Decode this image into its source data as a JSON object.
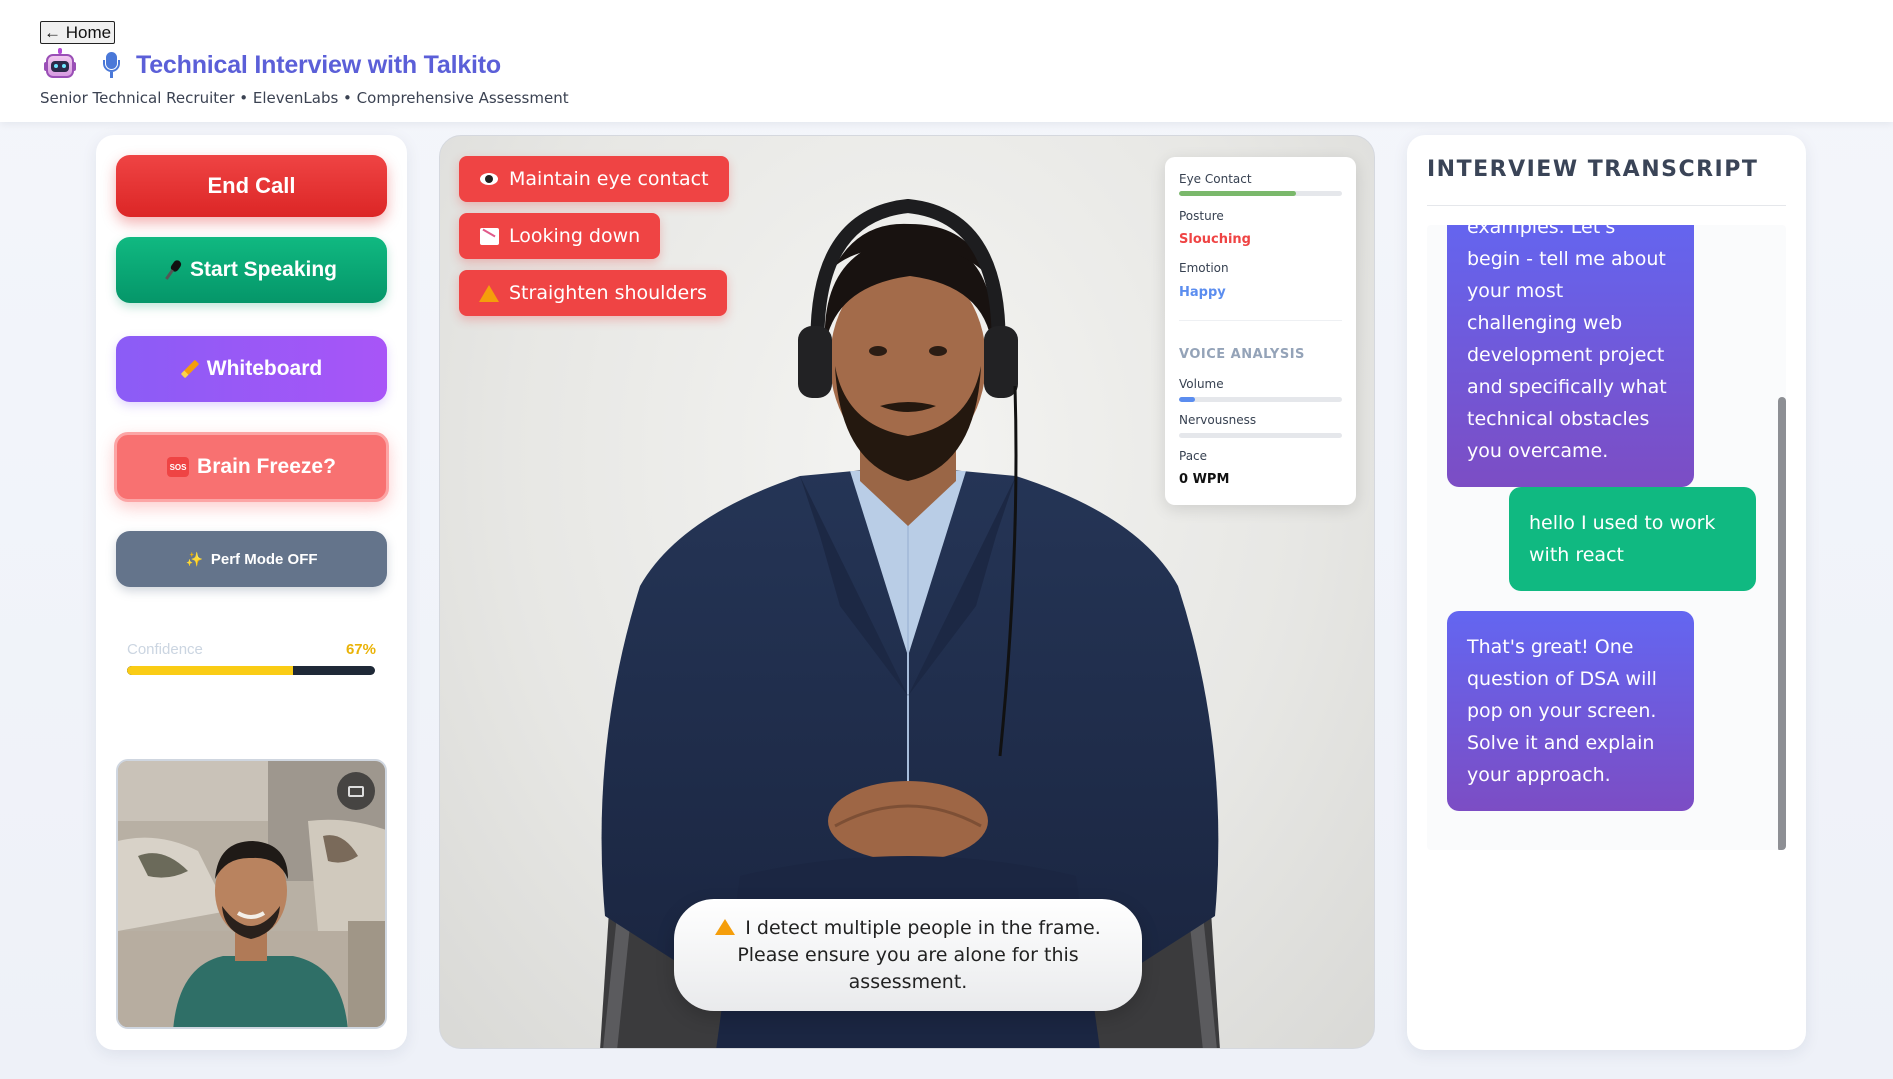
{
  "header": {
    "home_label": "← Home",
    "title": "Technical Interview with Talkito",
    "subtitle": "Senior Technical Recruiter • ElevenLabs • Comprehensive Assessment"
  },
  "controls": {
    "end_call": "End Call",
    "start_speaking": "Start Speaking",
    "whiteboard": "Whiteboard",
    "brain_freeze": "Brain Freeze?",
    "perf_mode": "Perf Mode OFF"
  },
  "confidence": {
    "label": "Confidence",
    "value": "67%",
    "fraction": 0.67
  },
  "alerts": [
    {
      "text": "Maintain eye contact",
      "icon": "eye-icon"
    },
    {
      "text": "Looking down",
      "icon": "chart-decreasing-icon"
    },
    {
      "text": "Straighten shoulders",
      "icon": "warning-icon"
    }
  ],
  "metrics": {
    "eye_contact_label": "Eye Contact",
    "eye_contact_fraction": 0.72,
    "posture_label": "Posture",
    "posture_value": "Slouching",
    "emotion_label": "Emotion",
    "emotion_value": "Happy",
    "voice_title": "VOICE ANALYSIS",
    "volume_label": "Volume",
    "volume_fraction": 0.1,
    "nervousness_label": "Nervousness",
    "nervousness_fraction": 0.0,
    "pace_label": "Pace",
    "pace_value": "0 WPM"
  },
  "toast": {
    "text": "I detect multiple people in the frame. Please ensure you are alone for this assessment."
  },
  "transcript": {
    "title": "INTERVIEW TRANSCRIPT",
    "messages": [
      {
        "role": "bot",
        "text": "examples. Let's begin - tell me about your most challenging web development project and specifically what technical obstacles you overcame."
      },
      {
        "role": "user",
        "text": "hello I used to work with react"
      },
      {
        "role": "bot",
        "text": "That's great! One question of DSA will pop on your screen. Solve it and explain your approach."
      }
    ]
  },
  "colors": {
    "accent": "#5b5fd8",
    "danger": "#ef4444",
    "success": "#10b981",
    "purple": "#8b5cf6",
    "posture_bad": "#ef4444",
    "emotion_happy": "#5b8def",
    "confidence": "#facc15"
  }
}
